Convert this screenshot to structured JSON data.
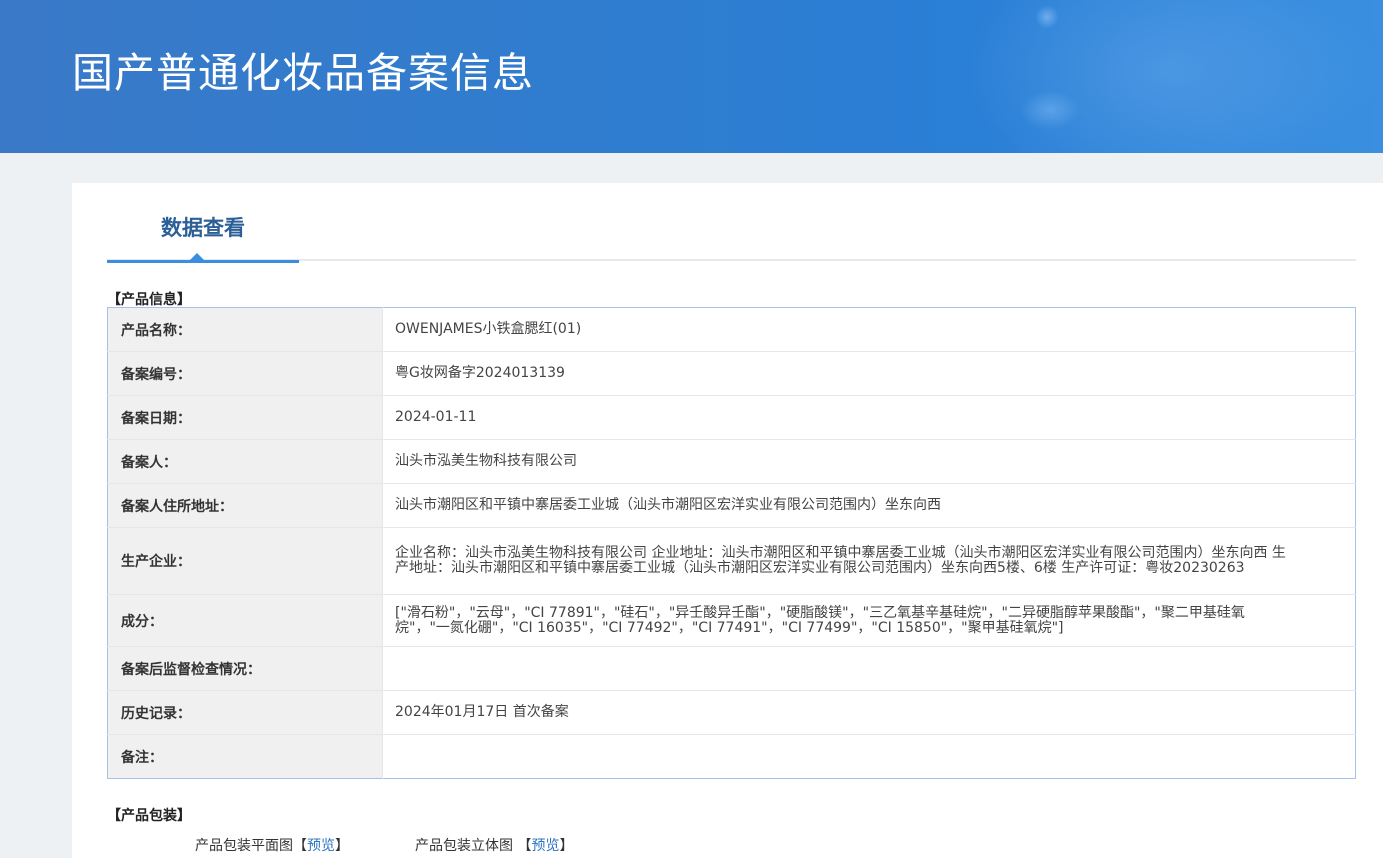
{
  "banner": {
    "title": "国产普通化妆品备案信息"
  },
  "tabs": [
    {
      "label": "数据查看",
      "active": true
    }
  ],
  "product_info": {
    "section_title": "【产品信息】",
    "rows": [
      {
        "label": "产品名称：",
        "value": "OWENJAMES小铁盒腮红(01)"
      },
      {
        "label": "备案编号：",
        "value": "粤G妆网备字2024013139"
      },
      {
        "label": "备案日期：",
        "value": "2024-01-11"
      },
      {
        "label": "备案人：",
        "value": "汕头市泓美生物科技有限公司"
      },
      {
        "label": "备案人住所地址：",
        "value": "汕头市潮阳区和平镇中寨居委工业城（汕头市潮阳区宏洋实业有限公司范围内）坐东向西"
      },
      {
        "label": "生产企业：",
        "value": "企业名称：汕头市泓美生物科技有限公司 企业地址：汕头市潮阳区和平镇中寨居委工业城（汕头市潮阳区宏洋实业有限公司范围内）坐东向西 生产地址：汕头市潮阳区和平镇中寨居委工业城（汕头市潮阳区宏洋实业有限公司范围内）坐东向西5楼、6楼 生产许可证：粤妆20230263"
      },
      {
        "label": "成分：",
        "value": "[\"滑石粉\"，\"云母\"，\"CI 77891\"，\"硅石\"，\"异壬酸异壬酯\"，\"硬脂酸镁\"，\"三乙氧基辛基硅烷\"，\"二异硬脂醇苹果酸酯\"，\"聚二甲基硅氧烷\"，\"一氮化硼\"，\"CI 16035\"，\"CI 77492\"，\"CI 77491\"，\"CI 77499\"，\"CI 15850\"，\"聚甲基硅氧烷\"]"
      },
      {
        "label": "备案后监督检查情况：",
        "value": ""
      },
      {
        "label": "历史记录：",
        "value": "2024年01月17日 首次备案"
      },
      {
        "label": "备注：",
        "value": ""
      }
    ]
  },
  "packaging": {
    "section_title": "【产品包装】",
    "flat_label": "产品包装平面图",
    "flat_link_open": "【",
    "flat_link": "预览",
    "flat_link_close": "】",
    "stereo_label": "产品包装立体图",
    "stereo_link_open": "【",
    "stereo_link": "预览",
    "stereo_link_close": "】"
  },
  "colors": {
    "banner_blue": "#2f7dd0",
    "tab_text": "#2d5f97",
    "tab_underline": "#3a8ee0",
    "link_blue": "#2a73c3",
    "table_border": "#a6c3e3"
  }
}
